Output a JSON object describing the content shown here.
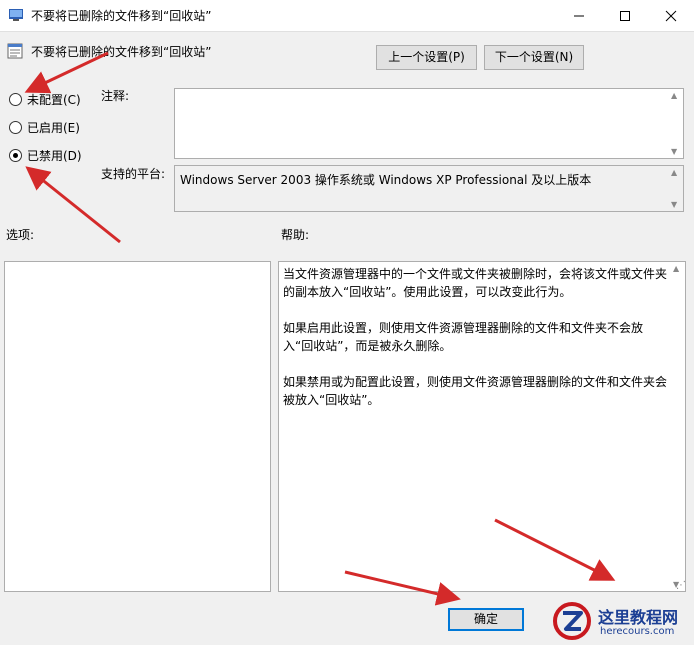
{
  "window": {
    "title": "不要将已删除的文件移到“回收站”",
    "icon": "policy-editor-icon",
    "controls": {
      "minimize": "minimize-icon",
      "maximize": "maximize-icon",
      "close": "close-icon"
    }
  },
  "policy": {
    "name": "不要将已删除的文件移到“回收站”",
    "icon": "policy-setting-icon"
  },
  "nav": {
    "prev_label": "上一个设置(P)",
    "next_label": "下一个设置(N)"
  },
  "state": {
    "options": [
      {
        "label": "未配置(C)",
        "selected": false
      },
      {
        "label": "已启用(E)",
        "selected": false
      },
      {
        "label": "已禁用(D)",
        "selected": true
      }
    ]
  },
  "comment": {
    "label": "注释:",
    "value": ""
  },
  "platform": {
    "label": "支持的平台:",
    "value": "Windows Server 2003 操作系统或 Windows XP Professional 及以上版本"
  },
  "options_panel": {
    "label": "选项:"
  },
  "help_panel": {
    "label": "帮助:",
    "paragraphs": [
      "当文件资源管理器中的一个文件或文件夹被删除时，会将该文件或文件夹的副本放入“回收站”。使用此设置，可以改变此行为。",
      "如果启用此设置，则使用文件资源管理器删除的文件和文件夹不会放入“回收站”，而是被永久删除。",
      "如果禁用或为配置此设置，则使用文件资源管理器删除的文件和文件夹会被放入“回收站”。"
    ]
  },
  "footer": {
    "ok_label": "确定"
  },
  "watermark": {
    "title": "这里教程网",
    "url": "herecours.com",
    "logo": "site-logo-icon"
  },
  "annotation_color": "#d42a2a"
}
